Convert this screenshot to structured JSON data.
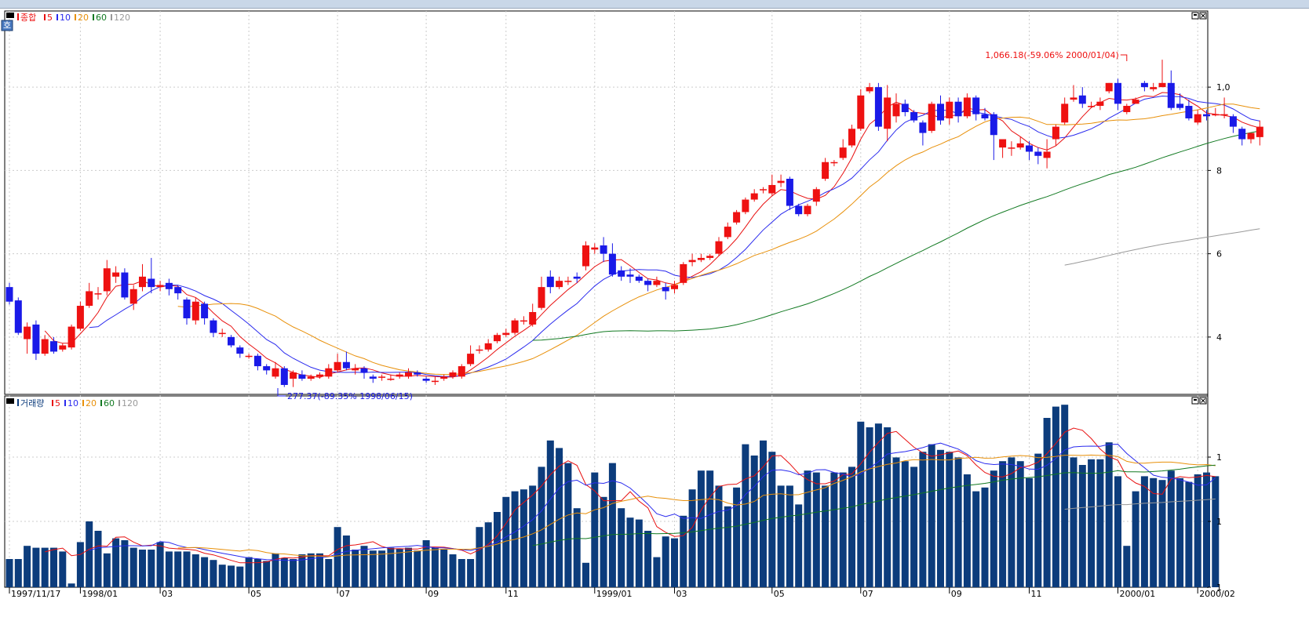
{
  "panes": {
    "price": {
      "title": "종합"
    },
    "volume": {
      "title": "거래량"
    }
  },
  "legend_periods": [
    "5",
    "10",
    "20",
    "60",
    "120"
  ],
  "colors": {
    "up": "#ee1111",
    "down": "#1a1ae8",
    "ma5": "#e81010",
    "ma10": "#2a2aee",
    "ma20": "#e8900a",
    "ma60": "#127a22",
    "ma120": "#999999",
    "volume_bar": "#0c3c7c",
    "frame": "#000000",
    "grid": "#cccccc"
  },
  "icons": {
    "pane_control": "window-control-icon",
    "chart_tool": "chart-tool-icon"
  },
  "chart_data": [
    {
      "type": "candlestick",
      "pane": "price",
      "x_labels": [
        "1997/11/17",
        "1998/01",
        "03",
        "05",
        "07",
        "09",
        "11",
        "1999/01",
        "03",
        "05",
        "07",
        "09",
        "11",
        "2000/01",
        "2000/02"
      ],
      "y_tick_labels": [
        "1,0",
        "8",
        "6",
        "4"
      ],
      "y_range": [
        300,
        1100
      ],
      "annotations": [
        {
          "text": "1,066.18(-59.06% 2000/01/04)",
          "color": "#ee1111",
          "value": 1066.18
        },
        {
          "text": "277.37(-89.35% 1998/06/15)",
          "color": "#1a1ae8",
          "value": 277.37
        }
      ],
      "candles": [
        [
          520,
          485,
          530,
          478
        ],
        [
          488,
          410,
          495,
          405
        ],
        [
          395,
          425,
          435,
          360
        ],
        [
          430,
          360,
          440,
          345
        ],
        [
          360,
          395,
          405,
          355
        ],
        [
          390,
          365,
          400,
          360
        ],
        [
          370,
          380,
          385,
          365
        ],
        [
          375,
          425,
          430,
          370
        ],
        [
          420,
          475,
          485,
          415
        ],
        [
          475,
          510,
          530,
          470
        ],
        [
          505,
          505,
          520,
          490
        ],
        [
          510,
          565,
          585,
          500
        ],
        [
          545,
          555,
          570,
          530
        ],
        [
          555,
          495,
          565,
          490
        ],
        [
          480,
          515,
          525,
          465
        ],
        [
          520,
          545,
          575,
          510
        ],
        [
          540,
          520,
          590,
          505
        ],
        [
          520,
          525,
          535,
          510
        ],
        [
          530,
          515,
          540,
          500
        ],
        [
          520,
          505,
          525,
          490
        ],
        [
          490,
          445,
          495,
          430
        ],
        [
          440,
          485,
          495,
          430
        ],
        [
          480,
          445,
          485,
          430
        ],
        [
          440,
          410,
          445,
          400
        ],
        [
          410,
          410,
          420,
          400
        ],
        [
          400,
          380,
          405,
          375
        ],
        [
          375,
          360,
          380,
          350
        ],
        [
          355,
          355,
          360,
          348
        ],
        [
          355,
          330,
          360,
          320
        ],
        [
          330,
          320,
          335,
          310
        ],
        [
          305,
          325,
          340,
          300
        ],
        [
          325,
          285,
          330,
          280
        ],
        [
          300,
          315,
          320,
          280
        ],
        [
          310,
          300,
          320,
          295
        ],
        [
          300,
          305,
          310,
          295
        ],
        [
          305,
          310,
          315,
          300
        ],
        [
          305,
          325,
          335,
          300
        ],
        [
          320,
          340,
          360,
          315
        ],
        [
          340,
          325,
          365,
          320
        ],
        [
          320,
          325,
          335,
          310
        ],
        [
          325,
          315,
          330,
          300
        ],
        [
          305,
          300,
          310,
          290
        ],
        [
          305,
          305,
          310,
          295
        ],
        [
          300,
          300,
          310,
          295
        ],
        [
          305,
          310,
          315,
          300
        ],
        [
          305,
          315,
          325,
          300
        ],
        [
          315,
          310,
          320,
          305
        ],
        [
          300,
          295,
          305,
          290
        ],
        [
          295,
          295,
          305,
          285
        ],
        [
          300,
          305,
          310,
          295
        ],
        [
          305,
          315,
          320,
          300
        ],
        [
          305,
          330,
          335,
          300
        ],
        [
          335,
          360,
          380,
          330
        ],
        [
          370,
          370,
          380,
          360
        ],
        [
          370,
          385,
          395,
          365
        ],
        [
          390,
          405,
          410,
          385
        ],
        [
          405,
          410,
          420,
          400
        ],
        [
          410,
          440,
          445,
          405
        ],
        [
          440,
          440,
          450,
          430
        ],
        [
          430,
          460,
          480,
          425
        ],
        [
          470,
          520,
          545,
          465
        ],
        [
          545,
          520,
          560,
          505
        ],
        [
          520,
          535,
          545,
          515
        ],
        [
          535,
          535,
          545,
          525
        ],
        [
          545,
          540,
          555,
          530
        ],
        [
          570,
          620,
          630,
          560
        ],
        [
          610,
          615,
          625,
          600
        ],
        [
          620,
          600,
          640,
          580
        ],
        [
          600,
          550,
          625,
          545
        ],
        [
          560,
          545,
          570,
          535
        ],
        [
          550,
          545,
          565,
          530
        ],
        [
          545,
          535,
          550,
          530
        ],
        [
          535,
          525,
          540,
          510
        ],
        [
          525,
          535,
          545,
          520
        ],
        [
          520,
          510,
          530,
          490
        ],
        [
          515,
          525,
          535,
          505
        ],
        [
          530,
          575,
          580,
          525
        ],
        [
          580,
          585,
          600,
          570
        ],
        [
          585,
          590,
          600,
          580
        ],
        [
          590,
          595,
          600,
          585
        ],
        [
          600,
          630,
          640,
          595
        ],
        [
          640,
          665,
          675,
          635
        ],
        [
          675,
          700,
          705,
          670
        ],
        [
          700,
          730,
          735,
          695
        ],
        [
          730,
          745,
          755,
          725
        ],
        [
          755,
          755,
          760,
          745
        ],
        [
          745,
          765,
          790,
          740
        ],
        [
          770,
          775,
          790,
          760
        ],
        [
          780,
          715,
          785,
          705
        ],
        [
          715,
          695,
          720,
          690
        ],
        [
          695,
          715,
          720,
          690
        ],
        [
          725,
          755,
          760,
          715
        ],
        [
          780,
          820,
          830,
          775
        ],
        [
          820,
          820,
          825,
          810
        ],
        [
          830,
          855,
          875,
          825
        ],
        [
          860,
          900,
          910,
          855
        ],
        [
          900,
          980,
          995,
          895
        ],
        [
          990,
          1000,
          1010,
          985
        ],
        [
          1000,
          905,
          1010,
          895
        ],
        [
          900,
          975,
          1005,
          870
        ],
        [
          930,
          960,
          985,
          915
        ],
        [
          960,
          940,
          970,
          930
        ],
        [
          940,
          920,
          945,
          915
        ],
        [
          915,
          890,
          920,
          860
        ],
        [
          895,
          960,
          965,
          890
        ],
        [
          960,
          920,
          980,
          910
        ],
        [
          925,
          965,
          975,
          910
        ],
        [
          965,
          930,
          975,
          915
        ],
        [
          930,
          975,
          985,
          925
        ],
        [
          975,
          935,
          980,
          920
        ],
        [
          935,
          925,
          950,
          920
        ],
        [
          935,
          885,
          940,
          825
        ],
        [
          855,
          875,
          870,
          830
        ],
        [
          855,
          855,
          870,
          835
        ],
        [
          855,
          865,
          880,
          850
        ],
        [
          860,
          845,
          870,
          825
        ],
        [
          845,
          835,
          855,
          815
        ],
        [
          830,
          845,
          875,
          805
        ],
        [
          875,
          905,
          910,
          860
        ],
        [
          915,
          960,
          975,
          910
        ],
        [
          970,
          975,
          1005,
          965
        ],
        [
          980,
          960,
          1000,
          950
        ],
        [
          955,
          955,
          965,
          950
        ],
        [
          955,
          965,
          975,
          945
        ],
        [
          990,
          1010,
          1010,
          985
        ],
        [
          1010,
          960,
          1020,
          945
        ],
        [
          940,
          955,
          960,
          935
        ],
        [
          960,
          970,
          975,
          960
        ],
        [
          1010,
          1000,
          1015,
          990
        ],
        [
          995,
          1000,
          1010,
          990
        ],
        [
          1000,
          1010,
          1066,
          1000
        ],
        [
          1010,
          950,
          1040,
          945
        ],
        [
          960,
          950,
          985,
          945
        ],
        [
          955,
          925,
          970,
          920
        ],
        [
          915,
          935,
          945,
          910
        ],
        [
          935,
          930,
          945,
          920
        ],
        [
          935,
          935,
          950,
          930
        ],
        [
          935,
          935,
          975,
          925
        ],
        [
          930,
          905,
          935,
          890
        ],
        [
          900,
          875,
          905,
          860
        ],
        [
          875,
          890,
          890,
          865
        ],
        [
          880,
          905,
          920,
          860
        ]
      ]
    },
    {
      "type": "bar",
      "pane": "volume",
      "x_labels": [
        "1997/11/17",
        "1998/01",
        "03",
        "05",
        "07",
        "09",
        "11",
        "1999/01",
        "03",
        "05",
        "07",
        "09",
        "11",
        "2000/01",
        "2000/02"
      ],
      "y_tick_labels": [
        "1",
        "1",
        "1"
      ],
      "y_range": [
        0,
        1000
      ],
      "values": [
        150,
        150,
        220,
        210,
        210,
        210,
        190,
        20,
        240,
        350,
        300,
        180,
        260,
        250,
        210,
        200,
        200,
        240,
        190,
        190,
        190,
        175,
        160,
        145,
        120,
        115,
        110,
        160,
        150,
        140,
        180,
        155,
        150,
        175,
        180,
        180,
        150,
        320,
        275,
        200,
        220,
        195,
        195,
        210,
        205,
        210,
        195,
        250,
        210,
        200,
        175,
        150,
        150,
        320,
        345,
        400,
        480,
        510,
        520,
        540,
        640,
        780,
        740,
        660,
        420,
        130,
        610,
        480,
        660,
        420,
        370,
        360,
        300,
        160,
        270,
        260,
        380,
        520,
        620,
        620,
        540,
        430,
        530,
        760,
        700,
        780,
        720,
        540,
        540,
        440,
        620,
        610,
        540,
        610,
        610,
        640,
        880,
        850,
        870,
        850,
        690,
        670,
        640,
        720,
        760,
        730,
        720,
        690,
        600,
        510,
        530,
        620,
        670,
        690,
        670,
        580,
        710,
        900,
        960,
        970,
        690,
        650,
        680,
        680,
        770,
        590,
        220,
        510,
        590,
        580,
        570,
        620,
        580,
        560,
        600,
        610,
        590
      ]
    }
  ]
}
